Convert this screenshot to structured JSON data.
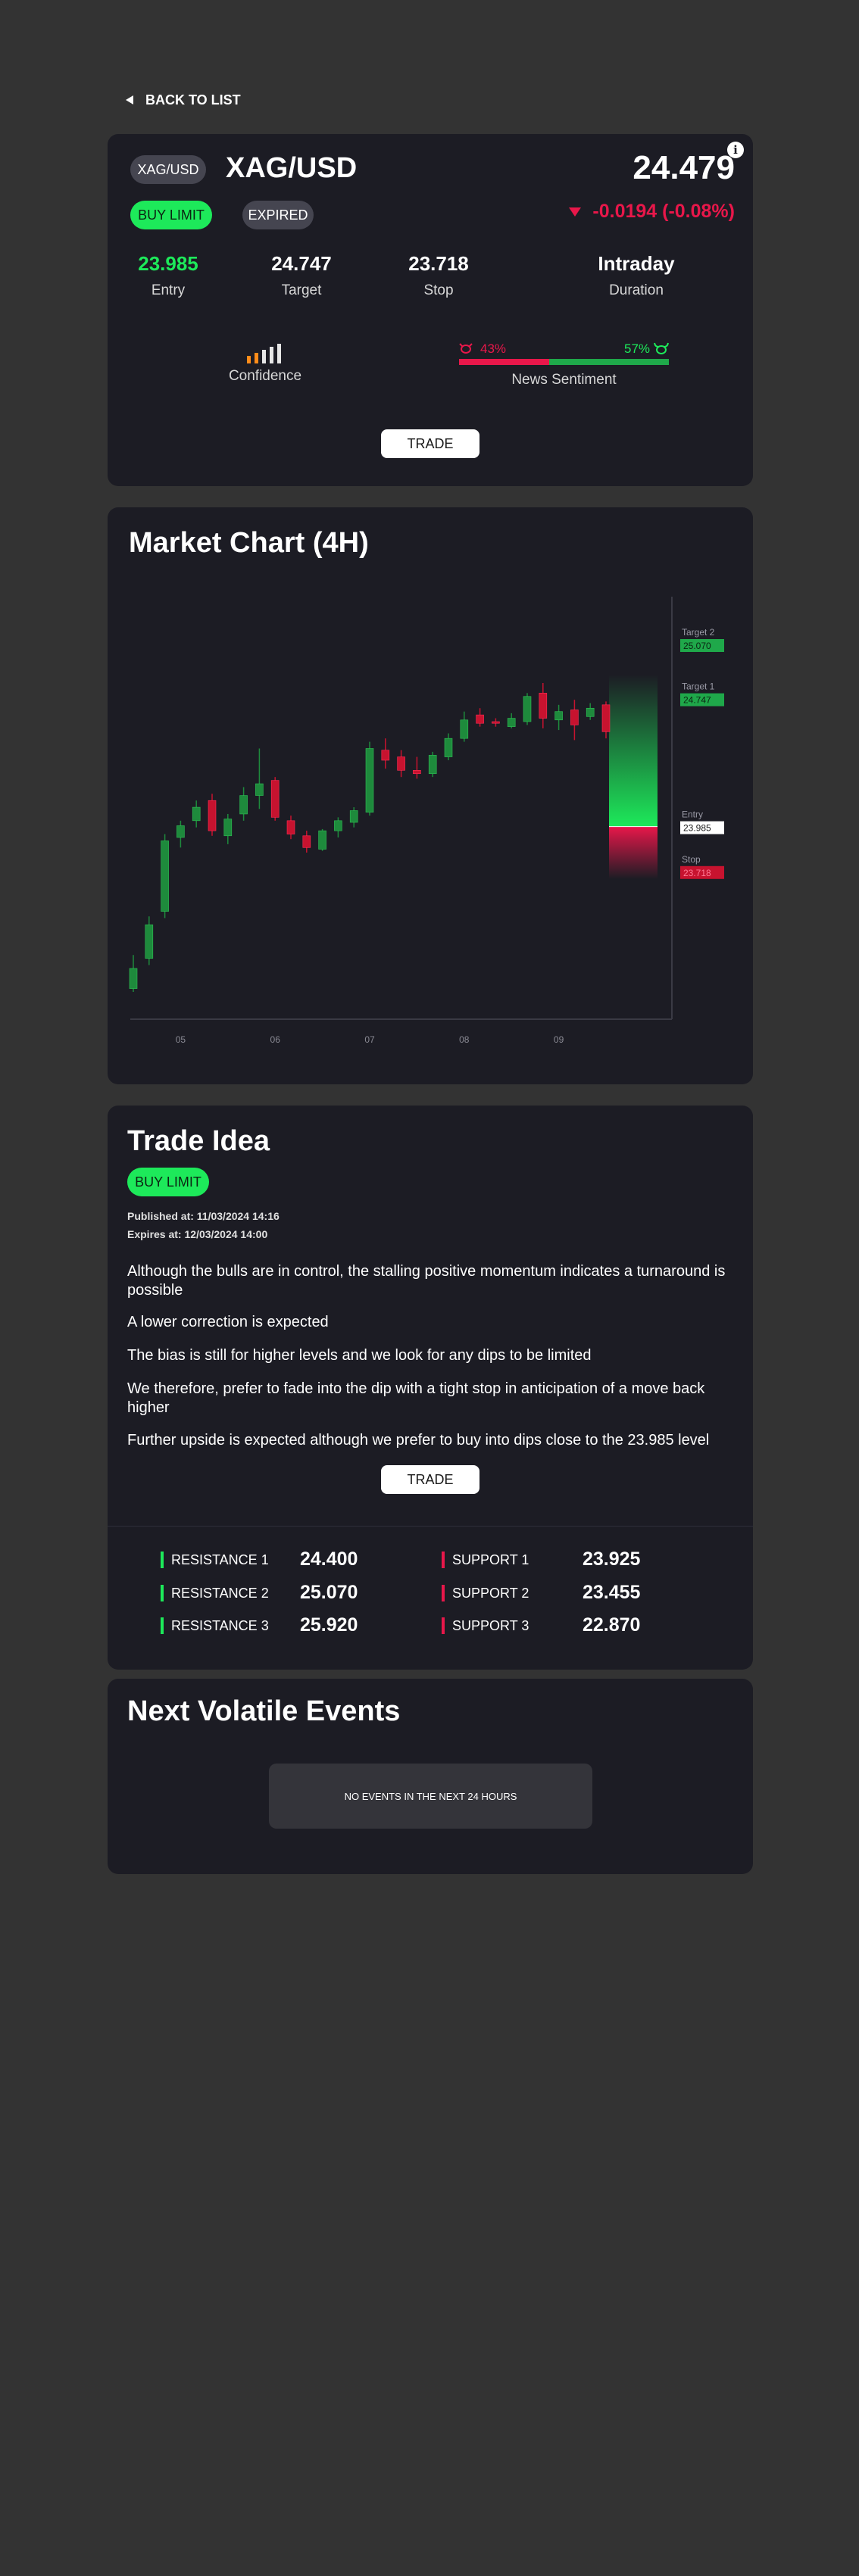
{
  "nav": {
    "back_label": "BACK TO LIST"
  },
  "header": {
    "symbol_badge": "XAG/USD",
    "symbol": "XAG/USD",
    "order_type": "BUY LIMIT",
    "status": "EXPIRED",
    "price": "24.479",
    "change": "-0.0194 (-0.08%)",
    "change_color": "#e8174a"
  },
  "stats": [
    {
      "value": "23.985",
      "label": "Entry",
      "color": "#1de95a"
    },
    {
      "value": "24.747",
      "label": "Target",
      "color": "#ffffff"
    },
    {
      "value": "23.718",
      "label": "Stop",
      "color": "#ffffff"
    },
    {
      "value": "Intraday",
      "label": "Duration",
      "color": "#ffffff"
    }
  ],
  "confidence": {
    "label": "Confidence",
    "level": 2,
    "max": 5
  },
  "sentiment": {
    "bear_pct": "43%",
    "bull_pct": "57%",
    "bear_value": 43,
    "bull_value": 57,
    "label": "News Sentiment"
  },
  "trade_label": "TRADE",
  "chart": {
    "title": "Market Chart (4H)",
    "x_labels": [
      "05",
      "06",
      "07",
      "08",
      "09"
    ],
    "levels": {
      "target2_label": "Target 2",
      "target2_value": "25.070",
      "target1_label": "Target 1",
      "target1_value": "24.747",
      "entry_label": "Entry",
      "entry_value": "23.985",
      "stop_label": "Stop",
      "stop_value": "23.718"
    },
    "colors": {
      "up": "#1e8a3c",
      "down": "#c7132f",
      "target": "#1de95a",
      "stop": "#e8174a"
    }
  },
  "chart_data": {
    "type": "candlestick",
    "title": "Market Chart (4H)",
    "x": [
      "05",
      "06",
      "07",
      "08",
      "09"
    ],
    "ylim": [
      23.0,
      25.3
    ],
    "candles": [
      {
        "o": 23.02,
        "h": 23.22,
        "l": 23.0,
        "c": 23.14
      },
      {
        "o": 23.2,
        "h": 23.45,
        "l": 23.16,
        "c": 23.4
      },
      {
        "o": 23.48,
        "h": 23.94,
        "l": 23.44,
        "c": 23.9
      },
      {
        "o": 23.92,
        "h": 24.02,
        "l": 23.86,
        "c": 23.99
      },
      {
        "o": 24.02,
        "h": 24.14,
        "l": 23.98,
        "c": 24.1
      },
      {
        "o": 24.14,
        "h": 24.18,
        "l": 23.93,
        "c": 23.96
      },
      {
        "o": 23.93,
        "h": 24.06,
        "l": 23.88,
        "c": 24.03
      },
      {
        "o": 24.06,
        "h": 24.22,
        "l": 24.02,
        "c": 24.17
      },
      {
        "o": 24.17,
        "h": 24.45,
        "l": 24.09,
        "c": 24.24
      },
      {
        "o": 24.26,
        "h": 24.28,
        "l": 24.02,
        "c": 24.04
      },
      {
        "o": 24.02,
        "h": 24.05,
        "l": 23.91,
        "c": 23.94
      },
      {
        "o": 23.93,
        "h": 23.96,
        "l": 23.83,
        "c": 23.86
      },
      {
        "o": 23.85,
        "h": 23.97,
        "l": 23.84,
        "c": 23.96
      },
      {
        "o": 23.96,
        "h": 24.04,
        "l": 23.92,
        "c": 24.02
      },
      {
        "o": 24.01,
        "h": 24.1,
        "l": 23.98,
        "c": 24.08
      },
      {
        "o": 24.07,
        "h": 24.49,
        "l": 24.05,
        "c": 24.45
      },
      {
        "o": 24.44,
        "h": 24.51,
        "l": 24.33,
        "c": 24.38
      },
      {
        "o": 24.4,
        "h": 24.44,
        "l": 24.28,
        "c": 24.32
      },
      {
        "o": 24.32,
        "h": 24.4,
        "l": 24.27,
        "c": 24.3
      },
      {
        "o": 24.3,
        "h": 24.43,
        "l": 24.28,
        "c": 24.41
      },
      {
        "o": 24.4,
        "h": 24.54,
        "l": 24.38,
        "c": 24.51
      },
      {
        "o": 24.51,
        "h": 24.67,
        "l": 24.49,
        "c": 24.62
      },
      {
        "o": 24.65,
        "h": 24.69,
        "l": 24.58,
        "c": 24.6
      },
      {
        "o": 24.61,
        "h": 24.63,
        "l": 24.58,
        "c": 24.6
      },
      {
        "o": 24.58,
        "h": 24.66,
        "l": 24.57,
        "c": 24.63
      },
      {
        "o": 24.61,
        "h": 24.78,
        "l": 24.59,
        "c": 24.76
      },
      {
        "o": 24.78,
        "h": 24.84,
        "l": 24.57,
        "c": 24.63
      },
      {
        "o": 24.62,
        "h": 24.71,
        "l": 24.56,
        "c": 24.67
      },
      {
        "o": 24.68,
        "h": 24.74,
        "l": 24.5,
        "c": 24.59
      },
      {
        "o": 24.64,
        "h": 24.72,
        "l": 24.62,
        "c": 24.69
      },
      {
        "o": 24.71,
        "h": 24.73,
        "l": 24.51,
        "c": 24.55
      }
    ],
    "levels": {
      "target2": 25.07,
      "target1": 24.747,
      "entry": 23.985,
      "stop": 23.718
    }
  },
  "trade_idea": {
    "title": "Trade Idea",
    "order_type": "BUY LIMIT",
    "published": "Published at: 11/03/2024 14:16",
    "expires": "Expires at: 12/03/2024 14:00",
    "paragraphs": [
      "Although the bulls are in control, the stalling positive momentum indicates a turnaround is possible",
      "A lower correction is expected",
      "The bias is still for higher levels and we look for any dips to be limited",
      "We therefore, prefer to fade into the dip with a tight stop in anticipation of a move back higher",
      "Further upside is expected although we prefer to buy into dips close to the 23.985 level"
    ],
    "resistances": [
      {
        "name": "RESISTANCE 1",
        "value": "24.400"
      },
      {
        "name": "RESISTANCE 2",
        "value": "25.070"
      },
      {
        "name": "RESISTANCE 3",
        "value": "25.920"
      }
    ],
    "supports": [
      {
        "name": "SUPPORT 1",
        "value": "23.925"
      },
      {
        "name": "SUPPORT 2",
        "value": "23.455"
      },
      {
        "name": "SUPPORT 3",
        "value": "22.870"
      }
    ]
  },
  "events": {
    "title": "Next Volatile Events",
    "empty_message": "NO EVENTS IN THE NEXT 24 HOURS"
  }
}
